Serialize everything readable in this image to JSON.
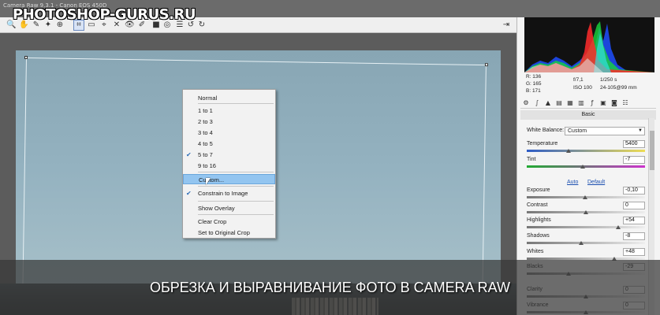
{
  "window": {
    "title": "Camera Raw 9.3.1  -  Canon EOS 450D"
  },
  "watermark": "PHOTOSHOP-GURUS.RU",
  "toolbar": {
    "tools": [
      {
        "icon": "zoom-icon",
        "glyph": "🔍"
      },
      {
        "icon": "hand-icon",
        "glyph": "✋"
      },
      {
        "icon": "white-balance-icon",
        "glyph": "✎"
      },
      {
        "icon": "color-sampler-icon",
        "glyph": "✦"
      },
      {
        "icon": "target-adjust-icon",
        "glyph": "⊕"
      },
      {
        "icon": "crop-icon",
        "glyph": "⌗"
      },
      {
        "icon": "straighten-icon",
        "glyph": "▭"
      },
      {
        "icon": "transform-icon",
        "glyph": "⌖"
      },
      {
        "icon": "spot-removal-icon",
        "glyph": "✕"
      },
      {
        "icon": "red-eye-icon",
        "glyph": "👁"
      },
      {
        "icon": "adjustment-brush-icon",
        "glyph": "✐"
      },
      {
        "icon": "graduated-filter-icon",
        "glyph": "■"
      },
      {
        "icon": "radial-filter-icon",
        "glyph": "◎"
      },
      {
        "icon": "preferences-icon",
        "glyph": "☰"
      },
      {
        "icon": "rotate-left-icon",
        "glyph": "↺"
      },
      {
        "icon": "rotate-right-icon",
        "glyph": "↻"
      }
    ],
    "fullscreen_glyph": "⇥"
  },
  "crop_menu": {
    "items": [
      "Normal",
      "1 to 1",
      "2 to 3",
      "3 to 4",
      "4 to 5",
      "5 to 7",
      "9 to 16",
      "Custom...",
      "Constrain to Image",
      "Show Overlay",
      "Clear Crop",
      "Set to Original Crop"
    ],
    "checked": [
      "5 to 7",
      "Constrain to Image"
    ],
    "highlighted": "Custom..."
  },
  "histogram_info": {
    "r": "R:   136",
    "g": "G:   165",
    "b": "B:   171",
    "aperture": "f/7,1",
    "shutter": "1/250 s",
    "iso": "ISO 100",
    "lens": "24-105@99 mm"
  },
  "panel": {
    "section_title": "Basic",
    "white_balance_label": "White Balance:",
    "white_balance_value": "Custom",
    "auto_link": "Auto",
    "default_link": "Default",
    "sliders": [
      {
        "label": "Temperature",
        "value": "5400",
        "level": 0.35
      },
      {
        "label": "Tint",
        "value": "-7",
        "level": 0.47
      },
      {
        "label": "Exposure",
        "value": "-0,10",
        "level": 0.49
      },
      {
        "label": "Contrast",
        "value": "0",
        "level": 0.5
      },
      {
        "label": "Highlights",
        "value": "+54",
        "level": 0.77
      },
      {
        "label": "Shadows",
        "value": "-8",
        "level": 0.46
      },
      {
        "label": "Whites",
        "value": "+48",
        "level": 0.74
      },
      {
        "label": "Blacks",
        "value": "-29",
        "level": 0.35
      },
      {
        "label": "Clarity",
        "value": "0",
        "level": 0.5
      },
      {
        "label": "Vibrance",
        "value": "0",
        "level": 0.5
      }
    ]
  },
  "caption": "ОБРЕЗКА И ВЫРАВНИВАНИЕ ФОТО В CAMERA RAW"
}
